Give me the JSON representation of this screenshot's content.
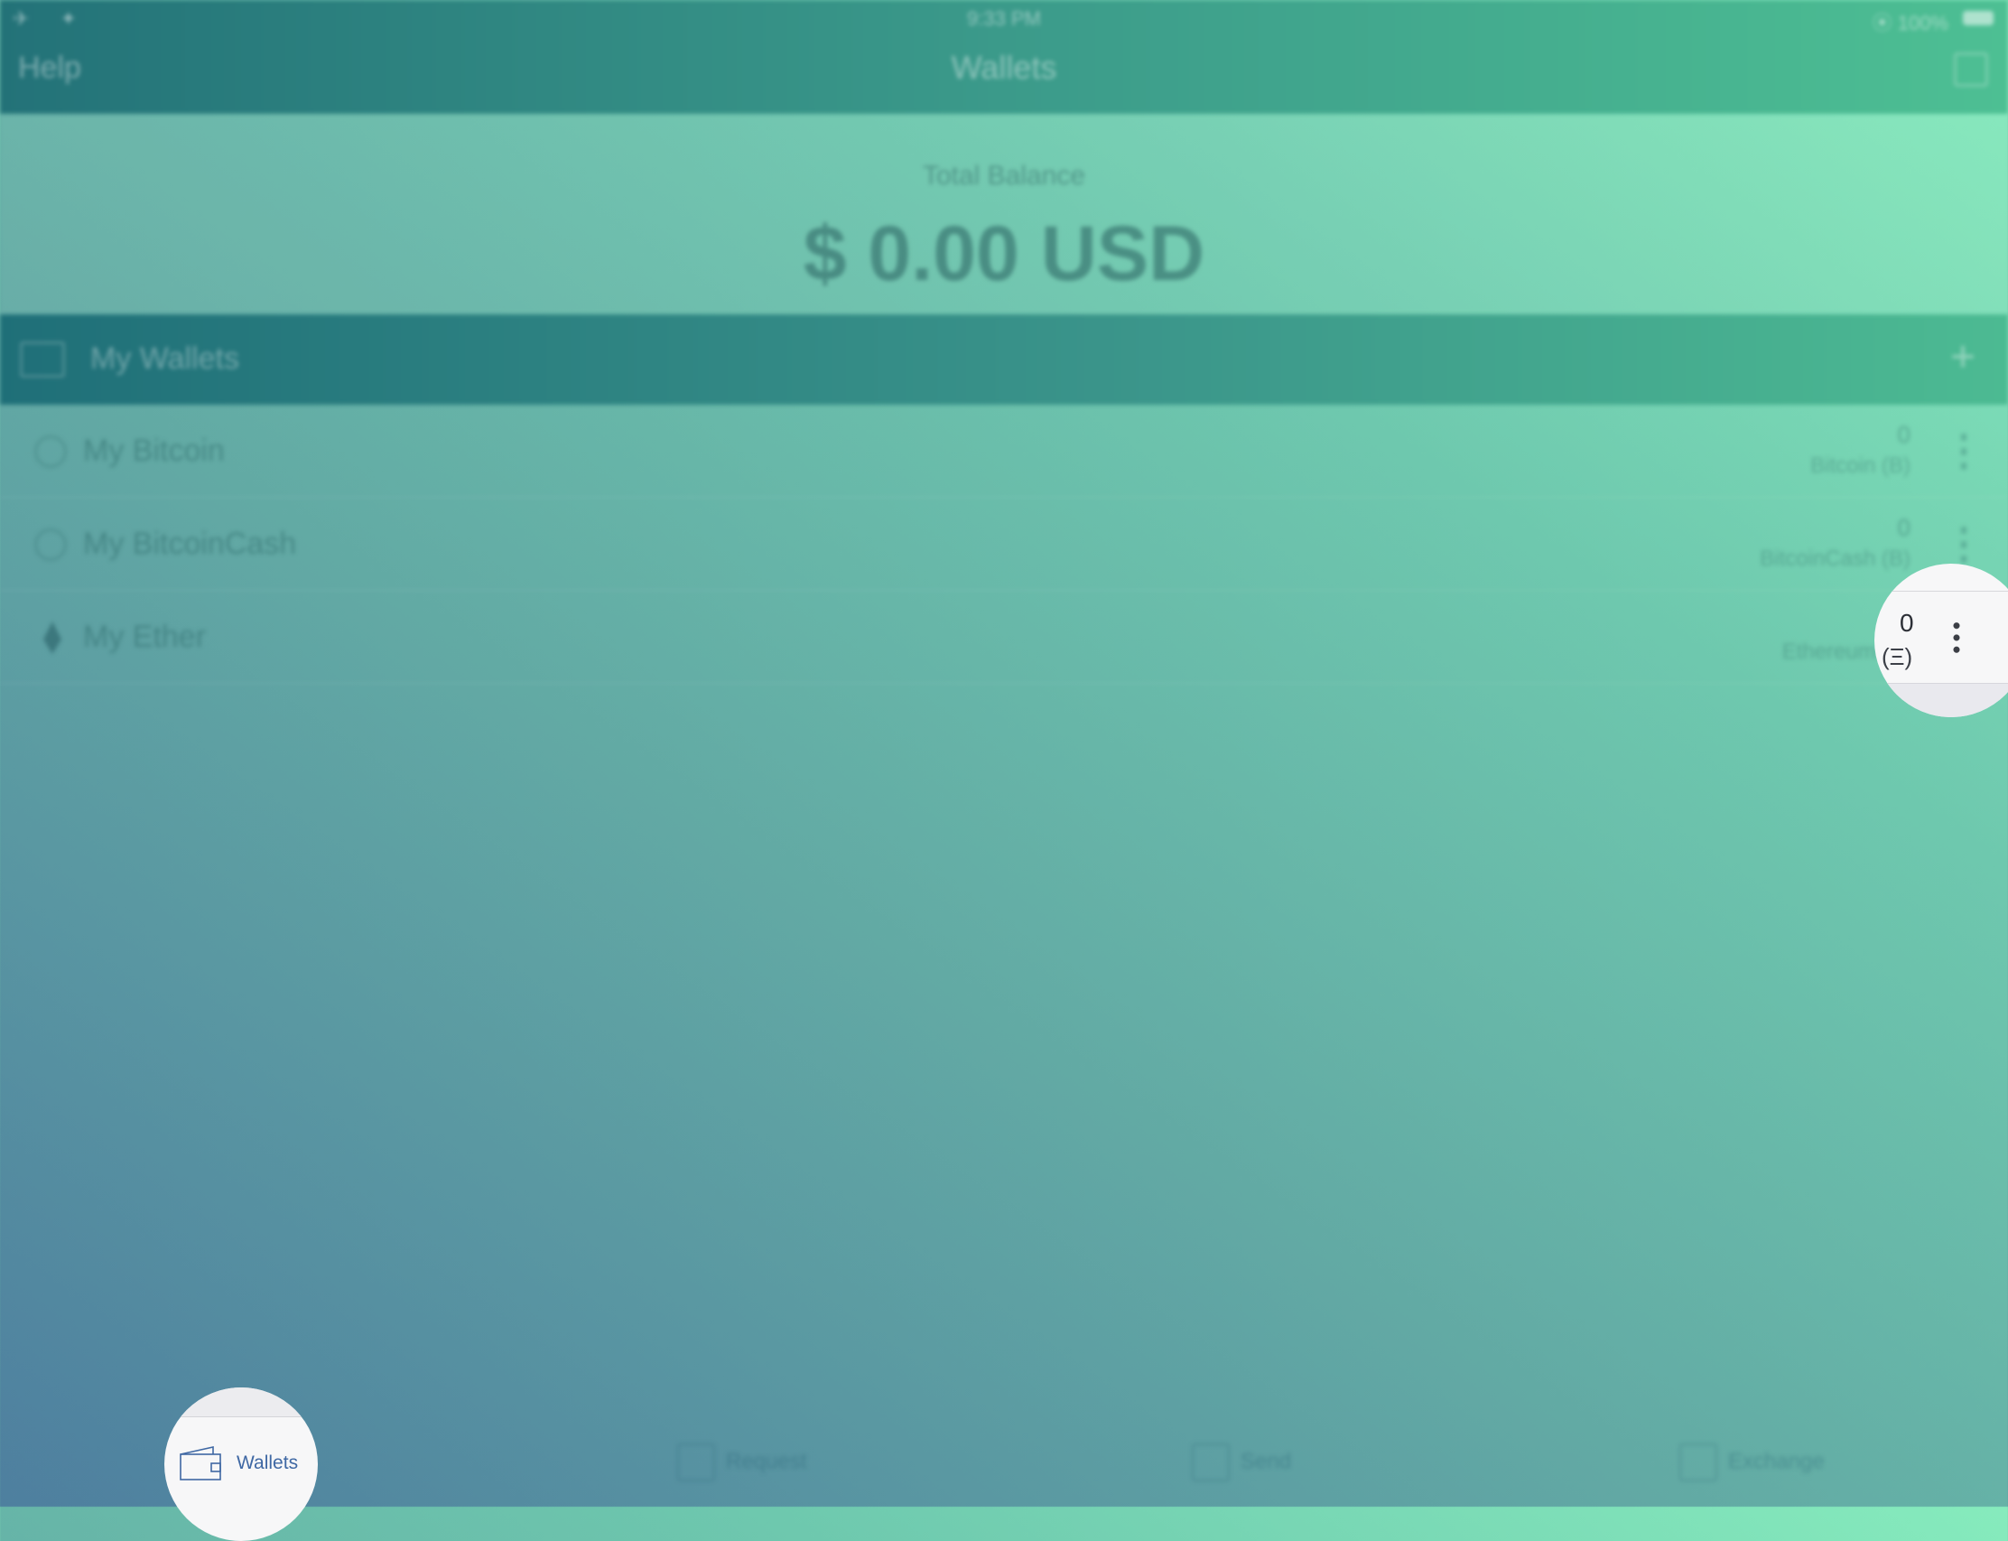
{
  "status_bar": {
    "left": "✈ ✦",
    "time": "9:33 PM",
    "right": "⦿ 100%"
  },
  "nav": {
    "left_button": "Help",
    "title": "Wallets"
  },
  "balance": {
    "label": "Total Balance",
    "amount": "$ 0.00 USD"
  },
  "section": {
    "title": "My Wallets",
    "add_label": "+"
  },
  "wallets": [
    {
      "name": "My Bitcoin",
      "balance": "0",
      "currency": "Bitcoin (B)"
    },
    {
      "name": "My BitcoinCash",
      "balance": "0",
      "currency": "BitcoinCash (B)"
    },
    {
      "name": "My Ether",
      "balance": "0",
      "currency": "Ethereum (Ξ)"
    }
  ],
  "zoom_row": {
    "balance": "0",
    "currency": "(Ξ)"
  },
  "tabs": [
    {
      "label": "Wallets",
      "icon": "wallet-icon"
    },
    {
      "label": "Request",
      "icon": "request-icon"
    },
    {
      "label": "Send",
      "icon": "send-icon"
    },
    {
      "label": "Exchange",
      "icon": "exchange-icon"
    }
  ],
  "colors": {
    "gradient_start": "#86ebbd",
    "gradient_end": "#4e7f9f",
    "nav_bar": "#237278",
    "tab_active": "#3f68a4"
  }
}
